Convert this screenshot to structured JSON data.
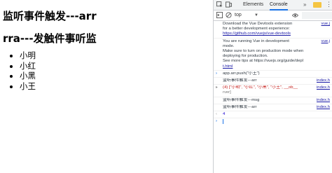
{
  "page": {
    "title1": "监听事件触发---arr",
    "title2": "rra---发触件事听监",
    "list_items": [
      "小明",
      "小红",
      "小黑",
      "小王"
    ]
  },
  "devtools": {
    "tabs": [
      "Elements",
      "Console"
    ],
    "tabs_more": "»",
    "context": "top",
    "context_arrow": "▼",
    "kebab": "⋮",
    "console": {
      "vue_devtools": [
        "Download the Vue Devtools extension",
        "for a better development experience:",
        "https://github.com/vuejs/vue-devtools"
      ],
      "vue_devtools_src": "vue.j",
      "dev_mode": [
        "You are running Vue in development",
        "mode.",
        "Make sure to turn on production mode when",
        "deploying for production.",
        "See more tips at https://vuejs.org/guide/depl",
        "t.html"
      ],
      "dev_mode_src": "vue.j",
      "command1": "app.arr.push(\"小王\")",
      "log1": "监听事件触发---arr",
      "log1_src": "index.h",
      "array_log": "(4) [\"小明\", \"小红\", \"小黑\", \"小王\", __ob__",
      "array_log_cont": "rver]",
      "array_src": "index.h",
      "log2": "监听事件触发---msg",
      "log2_src": "index.h",
      "log3": "监听事件触发---arr",
      "log3_src": "index.h",
      "result": "4"
    }
  }
}
